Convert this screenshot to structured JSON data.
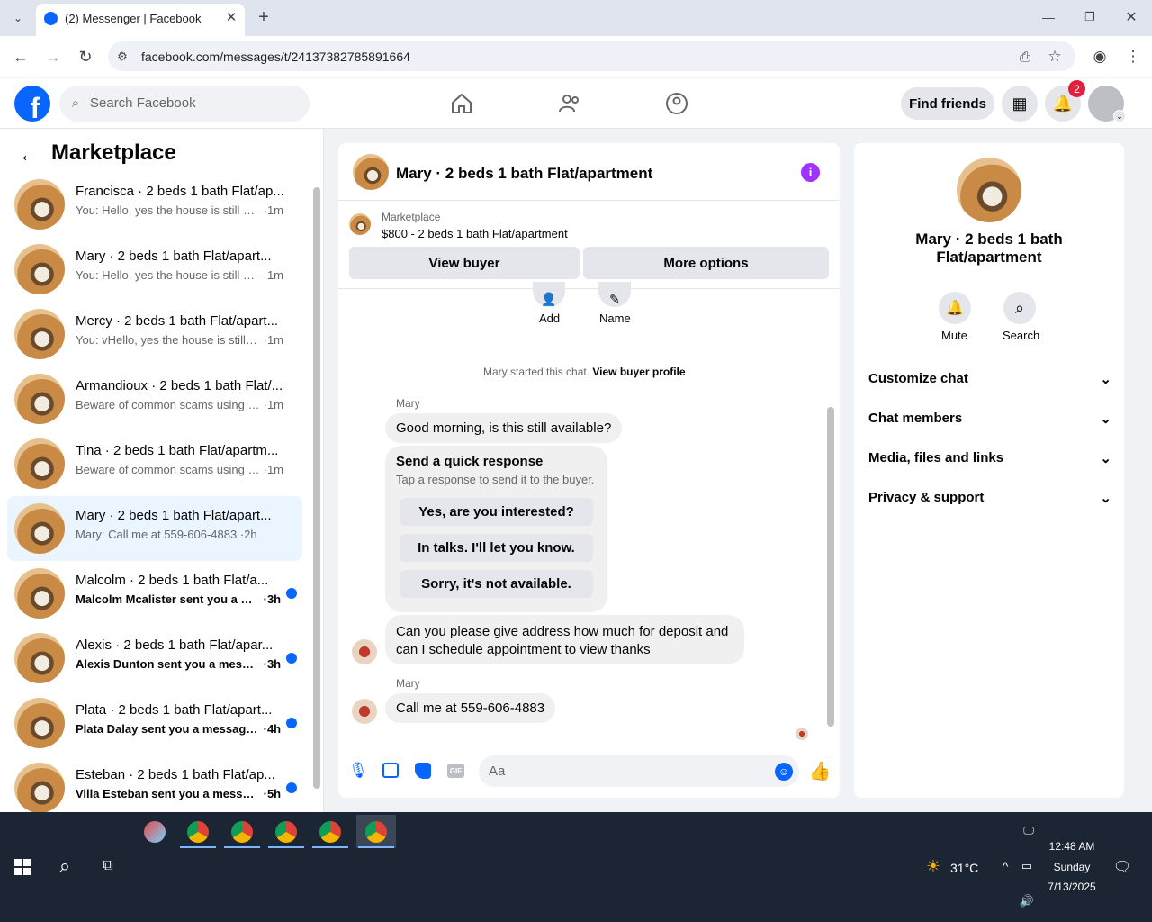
{
  "browser": {
    "tab_title": "(2) Messenger | Facebook",
    "url": "facebook.com/messages/t/24137382785891664"
  },
  "fb": {
    "search_placeholder": "Search Facebook",
    "find_friends": "Find friends",
    "notif_count": "2"
  },
  "sidebar": {
    "title": "Marketplace",
    "convos": [
      {
        "name": "Francisca · 2 beds 1 bath Flat/ap...",
        "preview": "You: Hello, yes the house is still av...",
        "time": "1m"
      },
      {
        "name": "Mary · 2 beds 1 bath Flat/apart...",
        "preview": "You: Hello, yes the house is still av...",
        "time": "1m"
      },
      {
        "name": "Mercy · 2 beds 1 bath Flat/apart...",
        "preview": "You: vHello, yes the house is still a...",
        "time": "1m"
      },
      {
        "name": "Armandioux · 2 beds 1 bath Flat/...",
        "preview": "Beware of common scams using p...",
        "time": "1m"
      },
      {
        "name": "Tina · 2 beds 1 bath Flat/apartm...",
        "preview": "Beware of common scams using p...",
        "time": "1m"
      },
      {
        "name": "Mary · 2 beds 1 bath Flat/apart...",
        "preview": "Mary: Call me at 559-606-4883",
        "time": "2h"
      },
      {
        "name": "Malcolm · 2 beds 1 bath Flat/a...",
        "preview": "Malcolm Mcalister sent you a m...",
        "time": "3h"
      },
      {
        "name": "Alexis · 2 beds 1 bath Flat/apar...",
        "preview": "Alexis Dunton sent you a messa...",
        "time": "3h"
      },
      {
        "name": "Plata · 2 beds 1 bath Flat/apart...",
        "preview": "Plata Dalay sent you a message ...",
        "time": "4h"
      },
      {
        "name": "Esteban · 2 beds 1 bath Flat/ap...",
        "preview": "Villa Esteban sent you a messag...",
        "time": "5h"
      }
    ]
  },
  "chat": {
    "title": "Mary · 2 beds 1 bath Flat/apartment",
    "listing_label": "Marketplace",
    "listing": "$800 - 2 beds 1 bath Flat/apartment",
    "view_buyer": "View buyer",
    "more_options": "More options",
    "add": "Add",
    "name": "Name",
    "started": "Mary started this chat.",
    "view_profile": "View buyer profile",
    "sender": "Mary",
    "msg1": "Good morning, is this still available?",
    "quick_title": "Send a quick response",
    "quick_sub": "Tap a response to send it to the buyer.",
    "qr1": "Yes, are you interested?",
    "qr2": "In talks. I'll let you know.",
    "qr3": "Sorry, it's not available.",
    "msg2_l1": "Can you please give address how much for deposit and",
    "msg2_l2": "can I schedule appointment to view thanks",
    "msg3": "Call me at 559-606-4883",
    "input_placeholder": "Aa",
    "gif": "GIF"
  },
  "info": {
    "title_l1": "Mary · 2 beds 1 bath",
    "title_l2": "Flat/apartment",
    "mute": "Mute",
    "search": "Search",
    "sections": [
      "Customize chat",
      "Chat members",
      "Media, files and links",
      "Privacy & support"
    ]
  },
  "taskbar": {
    "temp": "31°C",
    "time": "12:48 AM",
    "day": "Sunday",
    "date": "7/13/2025"
  }
}
